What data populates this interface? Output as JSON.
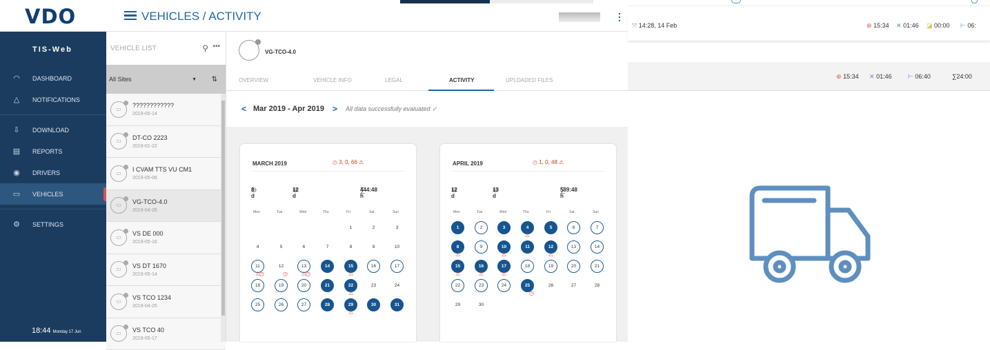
{
  "header": {
    "logo": "VDO",
    "page_title": "VEHICLES / ACTIVITY"
  },
  "sidebar": {
    "brand": "TIS-Web",
    "items": [
      {
        "label": "DASHBOARD",
        "icon": "speedometer-icon"
      },
      {
        "label": "NOTIFICATIONS",
        "icon": "bell-icon"
      },
      {
        "label": "DOWNLOAD",
        "icon": "download-icon"
      },
      {
        "label": "REPORTS",
        "icon": "report-icon"
      },
      {
        "label": "DRIVERS",
        "icon": "steering-wheel-icon"
      },
      {
        "label": "VEHICLES",
        "icon": "truck-icon",
        "active": true
      },
      {
        "label": "SETTINGS",
        "icon": "gear-icon"
      }
    ],
    "clock": {
      "time": "18:44",
      "date": "Monday 17 Jun"
    }
  },
  "vehicle_list": {
    "placeholder": "VEHICLE LIST",
    "site_filter": "All Sites",
    "items": [
      {
        "name": "????????????",
        "date": "2019-05-14"
      },
      {
        "name": "DT-CO 2223",
        "date": "2019-01-22"
      },
      {
        "name": "I CVAM TTS VU CM1",
        "date": "2019-05-06"
      },
      {
        "name": "VG-TCO-4.0",
        "date": "2019-04-26",
        "selected": true
      },
      {
        "name": "VS DE 000",
        "date": "2019-05-16"
      },
      {
        "name": "VS DT 1670",
        "date": "2019-05-14"
      },
      {
        "name": "VS TCO 1234",
        "date": "2019-04-25"
      },
      {
        "name": "VS TCO 40",
        "date": "2019-05-17"
      }
    ]
  },
  "vehicle": {
    "name": "VG-TCO-4.0"
  },
  "tabs": [
    "OVERVIEW",
    "VEHICLE INFO",
    "LEGAL",
    "ACTIVITY",
    "UPLOADED FILES"
  ],
  "period": {
    "label": "Mar 2019 - Apr 2019",
    "status": "All data successfully evaluated ✓"
  },
  "weekdays": [
    "Mon",
    "Tue",
    "Wed",
    "Thu",
    "Fri",
    "Sat",
    "Sun"
  ],
  "calendars": [
    {
      "month": "MARCH 2019",
      "counts": "3, 0, 66",
      "days_driven": "8 d",
      "days_free": "12 d",
      "total": "444:48 h"
    },
    {
      "month": "APRIL 2019",
      "counts": "1, 0, 48",
      "days_driven": "12 d",
      "days_free": "13 d",
      "total": "589:48 h"
    }
  ],
  "right_panel": {
    "range": "14:28, 14 Feb",
    "stats1": {
      "drive": "15:34",
      "work": "01:46",
      "avail": "00:00",
      "rest": "06:"
    },
    "stats2": {
      "drive": "15:34",
      "work": "01:46",
      "rest": "06:40",
      "total": "∑24:00"
    }
  },
  "colors": {
    "sidebar": "#1b3c5f",
    "accent": "#16558f",
    "warning": "#d9534f",
    "logo": "#103f6e"
  }
}
